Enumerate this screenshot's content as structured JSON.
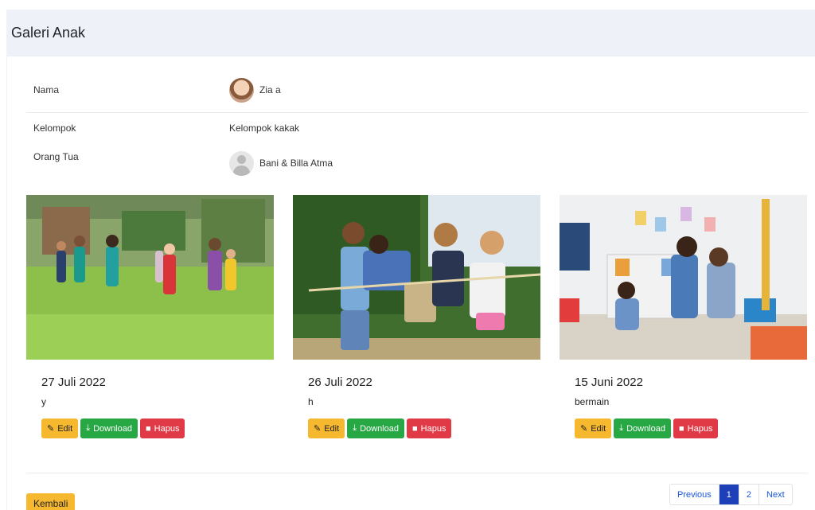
{
  "header": {
    "title": "Galeri Anak"
  },
  "profile": {
    "name_label": "Nama",
    "name_value": "Zia a",
    "group_label": "Kelompok",
    "group_value": "Kelompok kakak",
    "parent_label": "Orang Tua",
    "parent_value": "Bani & Billa Atma"
  },
  "gallery": [
    {
      "date": "27 Juli 2022",
      "caption": "y",
      "edit_label": "Edit",
      "download_label": "Download",
      "delete_label": "Hapus"
    },
    {
      "date": "26 Juli 2022",
      "caption": "h",
      "edit_label": "Edit",
      "download_label": "Download",
      "delete_label": "Hapus"
    },
    {
      "date": "15 Juni 2022",
      "caption": "bermain",
      "edit_label": "Edit",
      "download_label": "Download",
      "delete_label": "Hapus"
    }
  ],
  "footer": {
    "back_label": "Kembali",
    "pagination": {
      "previous": "Previous",
      "pages": [
        "1",
        "2"
      ],
      "active": "1",
      "next": "Next"
    }
  },
  "colors": {
    "edit": "#f5b82e",
    "download": "#28a745",
    "delete": "#e03a46",
    "active_page": "#1d3fb8",
    "header_bg": "#eef2f8"
  },
  "icons": {
    "edit": "edit-icon",
    "download": "download-icon",
    "delete": "trash-icon"
  }
}
